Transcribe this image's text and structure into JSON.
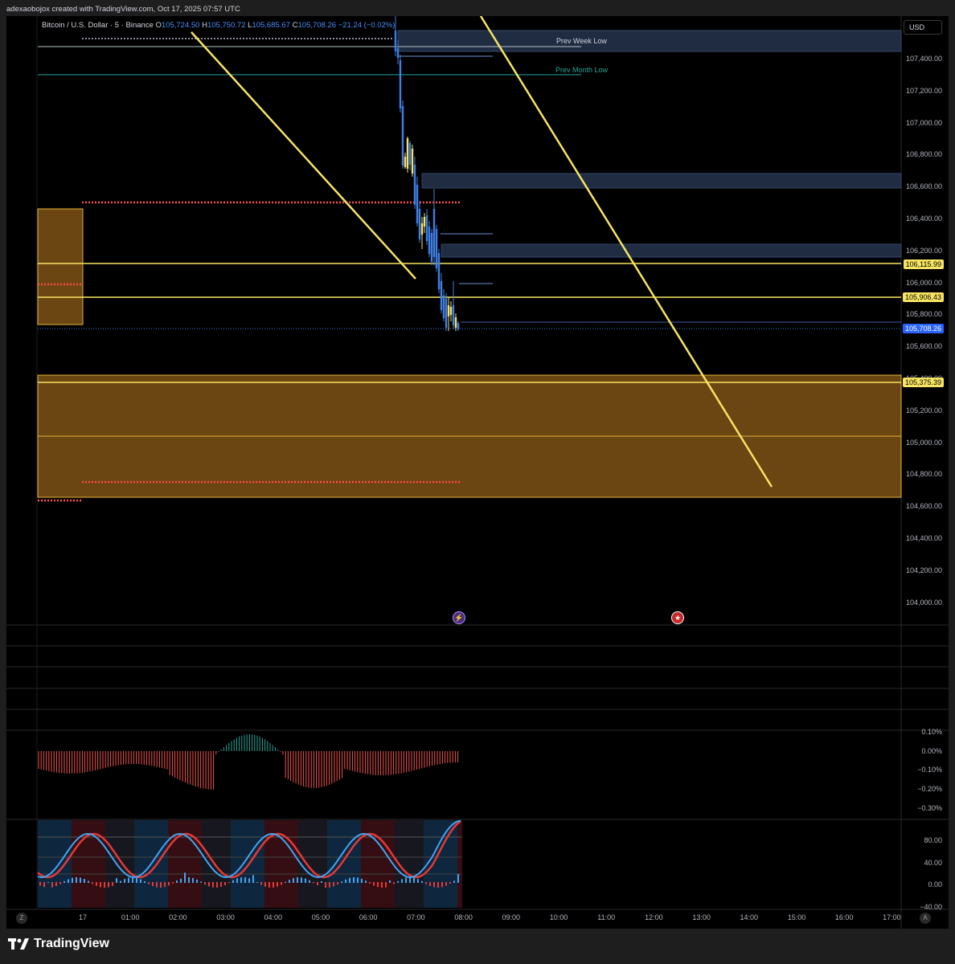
{
  "header": {
    "attribution": "adexaobojox created with TradingView.com, Oct 17, 2025 07:57 UTC"
  },
  "legend": {
    "symbol": "Bitcoin / U.S. Dollar · 5 · Binance",
    "open_label": "O",
    "open": "105,724.50",
    "high_label": "H",
    "high": "105,750.72",
    "low_label": "L",
    "low": "105,685.67",
    "close_label": "C",
    "close": "105,708.26",
    "change": "−21.24 (−0.02%)"
  },
  "currency": "USD",
  "price_axis": {
    "ticks": [
      "107,400.00",
      "107,200.00",
      "107,000.00",
      "106,800.00",
      "106,600.00",
      "106,400.00",
      "106,200.00",
      "106,000.00",
      "105,800.00",
      "105,600.00",
      "105,400.00",
      "105,200.00",
      "105,000.00",
      "104,800.00",
      "104,600.00",
      "104,400.00",
      "104,200.00",
      "104,000.00"
    ],
    "badges": {
      "level_1": "106,115.99",
      "level_2": "105,906.43",
      "last_price": "105,708.26",
      "level_3": "105,375.39"
    }
  },
  "levels": {
    "prev_week_low": "Prev Week Low",
    "prev_month_low": "Prev Month Low"
  },
  "time_axis": {
    "ticks": [
      "17",
      "01:00",
      "02:00",
      "03:00",
      "04:00",
      "05:00",
      "06:00",
      "07:00",
      "08:00",
      "09:00",
      "10:00",
      "11:00",
      "12:00",
      "13:00",
      "14:00",
      "15:00",
      "16:00",
      "17:00"
    ]
  },
  "osc1_axis": {
    "ticks": [
      "0.10%",
      "0.00%",
      "−0.10%",
      "−0.20%",
      "−0.30%"
    ]
  },
  "osc2_axis": {
    "ticks": [
      "80.00",
      "40.00",
      "0.00",
      "−40.00"
    ]
  },
  "corner_buttons": {
    "left": "Z",
    "right": "A"
  },
  "footer": {
    "brand": "TradingView"
  },
  "colors": {
    "background": "#000000",
    "bull_candle": "#3f7fe8",
    "bear_candle": "#f4e06b",
    "trendline": "#f7e463",
    "zone_fill": "#6b4512",
    "zone_border": "#e0b23a",
    "fvg_fill": "#1f2c42",
    "red_dots": "#ff4d4d",
    "last_price_badge": "#2962ff",
    "level_badge": "#f7e463"
  },
  "icons": {
    "event_1": "lightning-icon",
    "event_2": "us-flag-icon",
    "logo": "tradingview-logo-icon"
  }
}
